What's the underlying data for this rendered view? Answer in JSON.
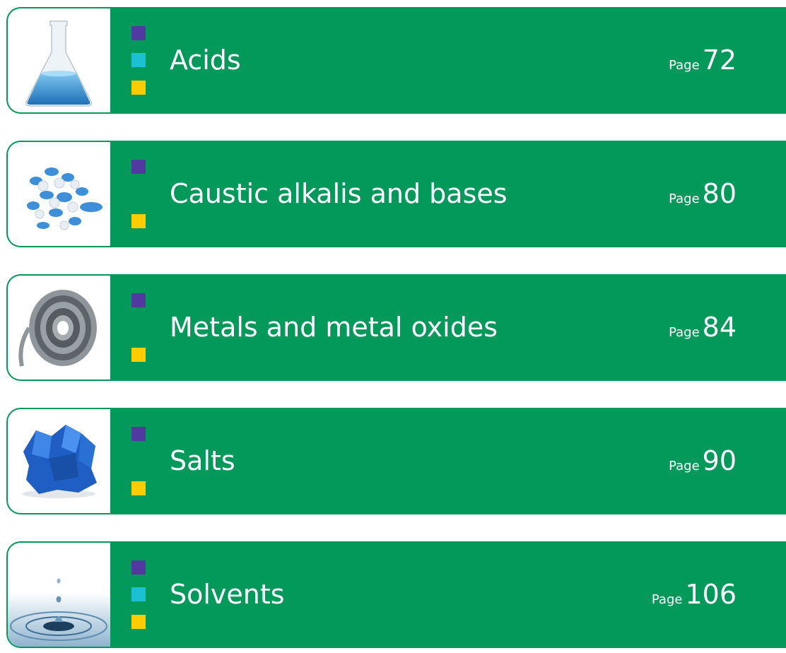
{
  "colors": {
    "band": "#03995a",
    "square_purple": "#503aa0",
    "square_cyan": "#1cc0d3",
    "square_yellow": "#ffcc00"
  },
  "entries": [
    {
      "title": "Acids",
      "page_word": "Page",
      "page_number": "72",
      "image_icon": "flask-icon",
      "squares": [
        "purple",
        "cyan",
        "yellow"
      ]
    },
    {
      "title": "Caustic alkalis and bases",
      "page_word": "Page",
      "page_number": "80",
      "image_icon": "pellets-icon",
      "squares": [
        "purple",
        "yellow"
      ]
    },
    {
      "title": "Metals and metal oxides",
      "page_word": "Page",
      "page_number": "84",
      "image_icon": "metal-coil-icon",
      "squares": [
        "purple",
        "yellow"
      ]
    },
    {
      "title": "Salts",
      "page_word": "Page",
      "page_number": "90",
      "image_icon": "blue-crystal-icon",
      "squares": [
        "purple",
        "yellow"
      ]
    },
    {
      "title": "Solvents",
      "page_word": "Page",
      "page_number": "106",
      "image_icon": "water-drop-icon",
      "squares": [
        "purple",
        "cyan",
        "yellow"
      ]
    }
  ]
}
